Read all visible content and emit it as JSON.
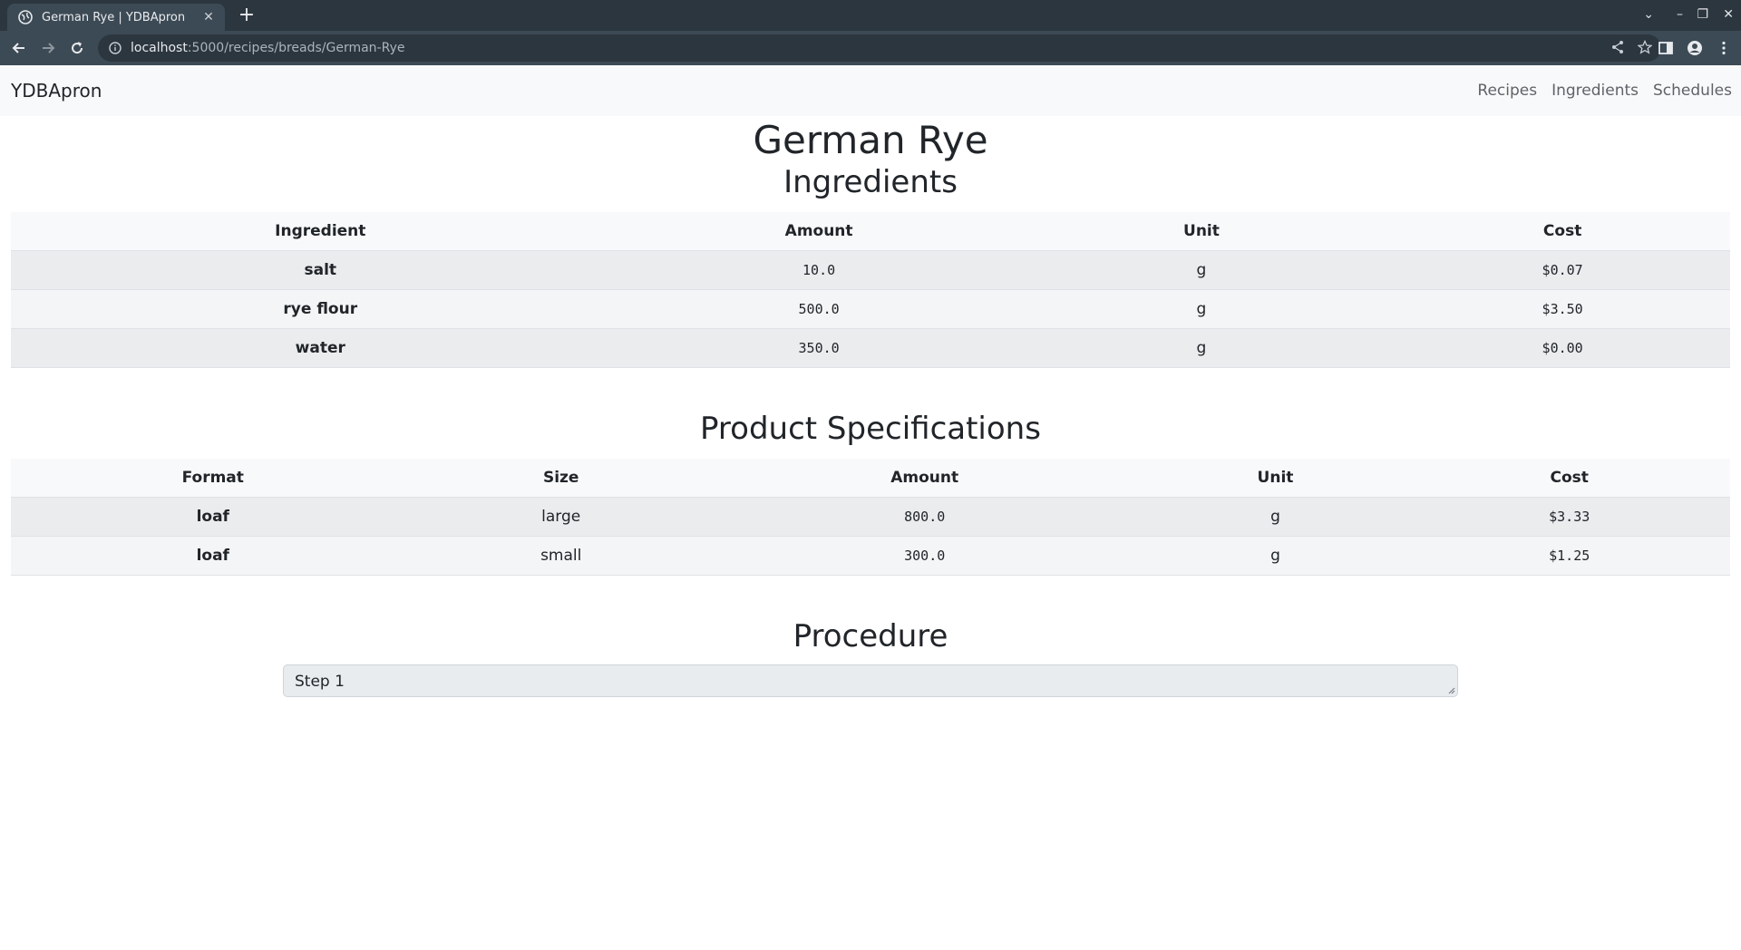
{
  "browser": {
    "tab_title": "German Rye | YDBApron",
    "url_host": "localhost",
    "url_rest": ":5000/recipes/breads/German-Rye"
  },
  "navbar": {
    "brand": "YDBApron",
    "links": [
      "Recipes",
      "Ingredients",
      "Schedules"
    ]
  },
  "page": {
    "title": "German Rye",
    "ingredients_heading": "Ingredients",
    "specs_heading": "Product Specifications",
    "procedure_heading": "Procedure"
  },
  "ingredients_table": {
    "headers": [
      "Ingredient",
      "Amount",
      "Unit",
      "Cost"
    ],
    "rows": [
      [
        "salt",
        "10.0",
        "g",
        "$0.07"
      ],
      [
        "rye flour",
        "500.0",
        "g",
        "$3.50"
      ],
      [
        "water",
        "350.0",
        "g",
        "$0.00"
      ]
    ]
  },
  "specs_table": {
    "headers": [
      "Format",
      "Size",
      "Amount",
      "Unit",
      "Cost"
    ],
    "rows": [
      [
        "loaf",
        "large",
        "800.0",
        "g",
        "$3.33"
      ],
      [
        "loaf",
        "small",
        "300.0",
        "g",
        "$1.25"
      ]
    ]
  },
  "procedure": {
    "steps": [
      "Step 1"
    ]
  },
  "icons": {
    "favicon": "globe-icon",
    "back": "back-arrow-icon",
    "forward": "forward-arrow-icon",
    "reload": "reload-icon",
    "info": "info-icon",
    "share": "share-icon",
    "bookmark": "star-icon",
    "sidepanel": "side-panel-icon",
    "profile": "profile-icon",
    "menu": "kebab-menu-icon"
  }
}
